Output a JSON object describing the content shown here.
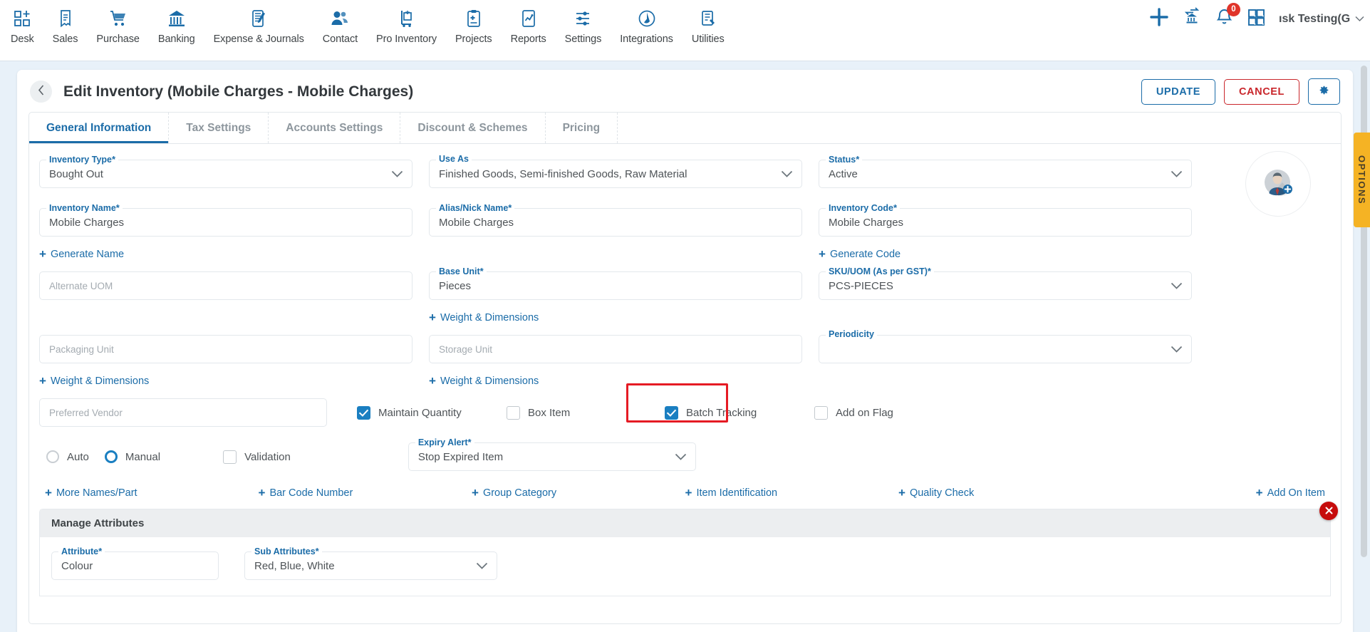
{
  "topnav": {
    "items": [
      {
        "label": "Desk",
        "icon": "desk-icon"
      },
      {
        "label": "Sales",
        "icon": "sales-receipt-icon"
      },
      {
        "label": "Purchase",
        "icon": "cart-icon"
      },
      {
        "label": "Banking",
        "icon": "bank-icon"
      },
      {
        "label": "Expense & Journals",
        "icon": "journal-icon"
      },
      {
        "label": "Contact",
        "icon": "people-icon"
      },
      {
        "label": "Pro Inventory",
        "icon": "inventory-trolley-icon"
      },
      {
        "label": "Projects",
        "icon": "clipboard-icon"
      },
      {
        "label": "Reports",
        "icon": "report-chart-icon"
      },
      {
        "label": "Settings",
        "icon": "sliders-icon"
      },
      {
        "label": "Integrations",
        "icon": "plug-icon"
      },
      {
        "label": "Utilities",
        "icon": "utilities-icon"
      }
    ],
    "right": {
      "add_icon": "plus-icon",
      "bank_transfer_icon": "bank-transfer-icon",
      "notification_icon": "bell-icon",
      "notification_count": "0",
      "apps_icon": "grid-apps-icon",
      "org_label": "ısk Testing(G",
      "org_chevron": "chevron-down-icon"
    }
  },
  "header": {
    "back_icon": "chevron-left-icon",
    "title": "Edit Inventory (Mobile Charges - Mobile Charges)",
    "update_label": "UPDATE",
    "cancel_label": "CANCEL",
    "gear_icon": "gear-icon"
  },
  "tabs": [
    {
      "label": "General Information",
      "active": true
    },
    {
      "label": "Tax Settings",
      "active": false
    },
    {
      "label": "Accounts Settings",
      "active": false
    },
    {
      "label": "Discount & Schemes",
      "active": false
    },
    {
      "label": "Pricing",
      "active": false
    }
  ],
  "form": {
    "inventory_type": {
      "label": "Inventory Type",
      "required": true,
      "value": "Bought Out"
    },
    "use_as": {
      "label": "Use As",
      "required": false,
      "value": "Finished Goods, Semi-finished Goods, Raw Material"
    },
    "status": {
      "label": "Status",
      "required": true,
      "value": "Active"
    },
    "inventory_name": {
      "label": "Inventory Name",
      "required": true,
      "value": "Mobile Charges"
    },
    "alias_nick_name": {
      "label": "Alias/Nick Name",
      "required": true,
      "value": "Mobile Charges"
    },
    "inventory_code": {
      "label": "Inventory Code",
      "required": true,
      "value": "Mobile Charges"
    },
    "generate_name": "Generate Name",
    "generate_code": "Generate Code",
    "alternate_uom": {
      "placeholder": "Alternate UOM",
      "value": ""
    },
    "base_unit": {
      "label": "Base Unit",
      "required": true,
      "value": "Pieces"
    },
    "sku_uom": {
      "label": "SKU/UOM (As per GST)",
      "required": true,
      "value": "PCS-PIECES"
    },
    "weight_dimensions_1": "Weight & Dimensions",
    "packaging_unit": {
      "placeholder": "Packaging Unit",
      "value": ""
    },
    "storage_unit": {
      "placeholder": "Storage Unit",
      "value": ""
    },
    "periodicity": {
      "label": "Periodicity",
      "required": false,
      "value": ""
    },
    "weight_dimensions_2": "Weight & Dimensions",
    "weight_dimensions_3": "Weight & Dimensions",
    "preferred_vendor": {
      "placeholder": "Preferred Vendor",
      "value": ""
    },
    "checkboxes": [
      {
        "label": "Maintain Quantity",
        "checked": true,
        "highlighted": false
      },
      {
        "label": "Box Item",
        "checked": false,
        "highlighted": false
      },
      {
        "label": "Batch Tracking",
        "checked": true,
        "highlighted": true
      },
      {
        "label": "Add on Flag",
        "checked": false,
        "highlighted": false
      }
    ],
    "radios": [
      {
        "label": "Auto",
        "selected": false
      },
      {
        "label": "Manual",
        "selected": true
      }
    ],
    "validation": {
      "label": "Validation",
      "checked": false
    },
    "expiry_alert": {
      "label": "Expiry Alert",
      "required": true,
      "value": "Stop Expired Item"
    },
    "add_links": [
      "More Names/Part",
      "Bar Code Number",
      "Group Category",
      "Item Identification",
      "Quality Check",
      "Add On Item"
    ]
  },
  "manage_attributes": {
    "title": "Manage Attributes",
    "close_icon": "close-icon",
    "attribute": {
      "label": "Attribute",
      "required": true,
      "value": "Colour"
    },
    "sub_attributes": {
      "label": "Sub Attributes",
      "required": true,
      "value": "Red, Blue, White"
    }
  },
  "avatar": {
    "icon": "add-user-avatar-icon"
  },
  "options_tab": {
    "label": "OPTIONS"
  },
  "colors": {
    "accent": "#1b6ca8",
    "danger": "#c9262b",
    "highlight": "#e51b24",
    "checkbox_checked": "#1a7fc1",
    "options_tab": "#f5b324",
    "page_bg": "#e8f1f9"
  }
}
